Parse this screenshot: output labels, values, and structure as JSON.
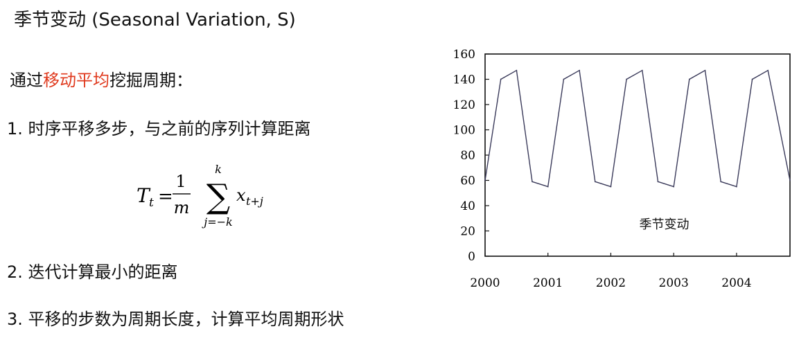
{
  "page": {
    "title": "季节变动 (Seasonal Variation, S)",
    "intro": {
      "prefix": "通过",
      "highlight": "移动平均",
      "suffix": "挖掘周期："
    },
    "steps": [
      "1. 时序平移多步，与之前的序列计算距离",
      "2. 迭代计算最小的距离",
      "3. 平移的步数为周期长度，计算平均周期形状"
    ],
    "formula": {
      "lhs": "T",
      "lhs_sub": "t",
      "equals": "=",
      "numerator": "1",
      "denominator": "m",
      "sigma": "∑",
      "upper": "k",
      "lower": "j=−k",
      "term": "x",
      "term_sub": "t+j"
    },
    "colors": {
      "accent": "#e03a1e",
      "text": "#111111",
      "line": "#3a3a5a",
      "axis": "#111111"
    }
  },
  "chart_data": {
    "type": "line",
    "annotation": "季节变动",
    "x_ticks": [
      "2000",
      "2001",
      "2002",
      "2003",
      "2004"
    ],
    "y_ticks": [
      0,
      20,
      40,
      60,
      80,
      100,
      120,
      140,
      160
    ],
    "ylim": [
      0,
      160
    ],
    "xlim": [
      2000,
      2004.85
    ],
    "grid": false,
    "series": [
      {
        "x": [
          2000,
          2000.25,
          2000.5,
          2000.75,
          2001,
          2001.25,
          2001.5,
          2001.75,
          2002,
          2002.25,
          2002.5,
          2002.75,
          2003,
          2003.25,
          2003.5,
          2003.75,
          2004,
          2004.25,
          2004.5,
          2004.85
        ],
        "values": [
          60,
          140,
          147,
          59,
          55,
          140,
          147,
          59,
          55,
          140,
          147,
          59,
          55,
          140,
          147,
          59,
          55,
          140,
          147,
          60
        ]
      }
    ]
  }
}
